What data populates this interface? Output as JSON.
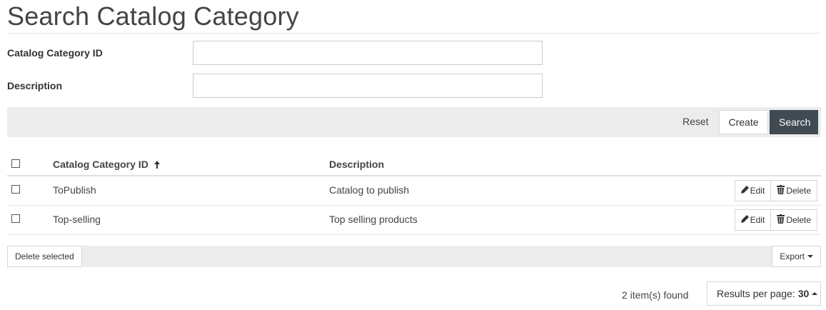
{
  "page": {
    "title": "Search Catalog Category"
  },
  "form": {
    "fields": [
      {
        "label": "Catalog Category ID",
        "value": "",
        "placeholder": ""
      },
      {
        "label": "Description",
        "value": "",
        "placeholder": ""
      }
    ]
  },
  "actions": {
    "reset_label": "Reset",
    "create_label": "Create",
    "search_label": "Search"
  },
  "table": {
    "columns": [
      "Catalog Category ID",
      "Description"
    ],
    "sort_icon": "arrow-up-icon",
    "rows": [
      {
        "id": "ToPublish",
        "description": "Catalog to publish"
      },
      {
        "id": "Top-selling",
        "description": "Top selling products"
      }
    ],
    "edit_label": "Edit",
    "delete_label": "Delete"
  },
  "footer": {
    "delete_selected_label": "Delete selected",
    "export_label": "Export",
    "items_found": "2 item(s) found",
    "results_per_page_label": "Results per page:",
    "results_per_page_value": "30"
  },
  "colors": {
    "primary_button": "#3f4a52",
    "toolbar_bg": "#ececec"
  }
}
